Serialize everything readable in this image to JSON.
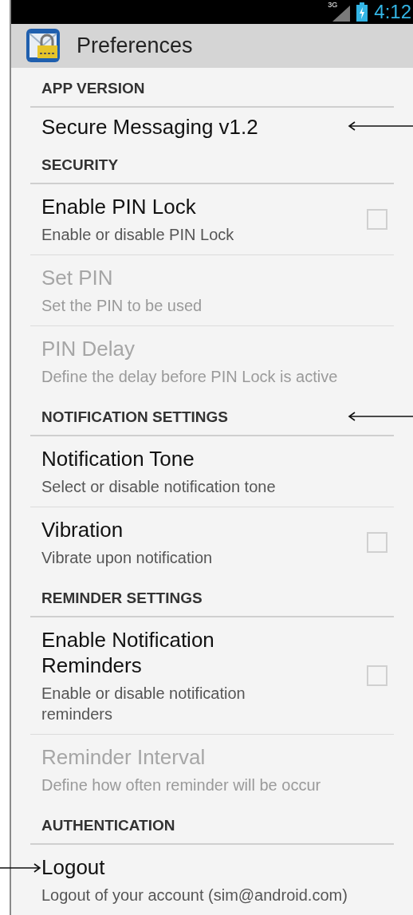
{
  "status_bar": {
    "network": "3G",
    "time": "4:12"
  },
  "action_bar": {
    "title": "Preferences"
  },
  "sections": [
    {
      "header": "APP VERSION",
      "items": [
        {
          "kind": "info",
          "title": "Secure Messaging v1.2",
          "disabled": false,
          "arrow_from_right": true
        }
      ]
    },
    {
      "header": "SECURITY",
      "items": [
        {
          "kind": "checkbox",
          "title": "Enable PIN Lock",
          "summary": "Enable or disable PIN Lock",
          "disabled": false,
          "checked": false
        },
        {
          "kind": "plain",
          "title": "Set PIN",
          "summary": "Set the PIN to be used",
          "disabled": true
        },
        {
          "kind": "plain",
          "title": "PIN Delay",
          "summary": "Define the delay before PIN Lock is active",
          "disabled": true
        }
      ]
    },
    {
      "header": "NOTIFICATION SETTINGS",
      "arrow_from_right": true,
      "items": [
        {
          "kind": "plain",
          "title": "Notification Tone",
          "summary": "Select or disable notification tone",
          "disabled": false
        },
        {
          "kind": "checkbox",
          "title": "Vibration",
          "summary": "Vibrate upon notification",
          "disabled": false,
          "checked": false
        }
      ]
    },
    {
      "header": "REMINDER SETTINGS",
      "items": [
        {
          "kind": "checkbox",
          "title": "Enable Notification Reminders",
          "summary": "Enable or disable notification reminders",
          "disabled": false,
          "checked": false
        },
        {
          "kind": "plain",
          "title": "Reminder Interval",
          "summary": "Define how often reminder will be occur",
          "disabled": true
        }
      ]
    },
    {
      "header": "AUTHENTICATION",
      "items": [
        {
          "kind": "plain",
          "title": "Logout",
          "summary": "Logout of your account (sim@android.com)",
          "disabled": false,
          "arrow_from_left": true
        }
      ]
    }
  ]
}
